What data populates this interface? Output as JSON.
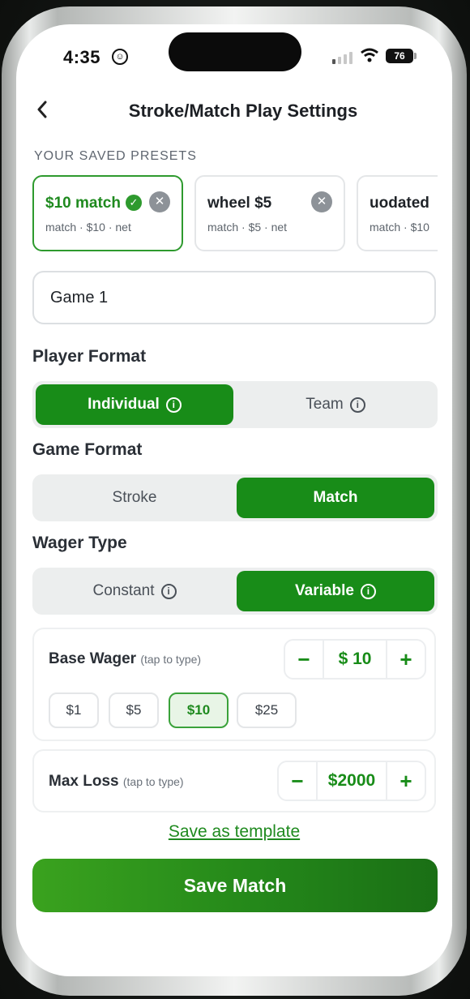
{
  "status": {
    "time": "4:35",
    "battery": "76"
  },
  "header": {
    "title": "Stroke/Match Play Settings"
  },
  "presets": {
    "section_label": "YOUR SAVED PRESETS",
    "items": [
      {
        "name": "$10 match",
        "desc": "match · $10 · net",
        "selected": true
      },
      {
        "name": "wheel $5",
        "desc": "match · $5 · net",
        "selected": false
      },
      {
        "name": "uodated",
        "desc": "match · $10",
        "selected": false
      }
    ]
  },
  "game_name": {
    "value": "Game 1"
  },
  "player_format": {
    "label": "Player Format",
    "options": [
      "Individual",
      "Team"
    ],
    "selected": "Individual"
  },
  "game_format": {
    "label": "Game Format",
    "options": [
      "Stroke",
      "Match"
    ],
    "selected": "Match"
  },
  "wager_type": {
    "label": "Wager Type",
    "options": [
      "Constant",
      "Variable"
    ],
    "selected": "Variable"
  },
  "base_wager": {
    "label": "Base Wager",
    "hint": "(tap to type)",
    "value": "$ 10",
    "chips": [
      "$1",
      "$5",
      "$10",
      "$25"
    ],
    "selected_chip": "$10"
  },
  "max_loss": {
    "label": "Max Loss",
    "hint": "(tap to type)",
    "value": "$2000"
  },
  "actions": {
    "template_link": "Save as template",
    "save_button": "Save Match"
  },
  "colors": {
    "accent": "#188c18",
    "accent_light": "#e8f5e6"
  },
  "icons": [
    "back-chevron-icon",
    "close-icon",
    "check-icon",
    "info-icon",
    "minus-icon",
    "plus-icon",
    "wifi-icon",
    "signal-icon",
    "battery-icon"
  ]
}
